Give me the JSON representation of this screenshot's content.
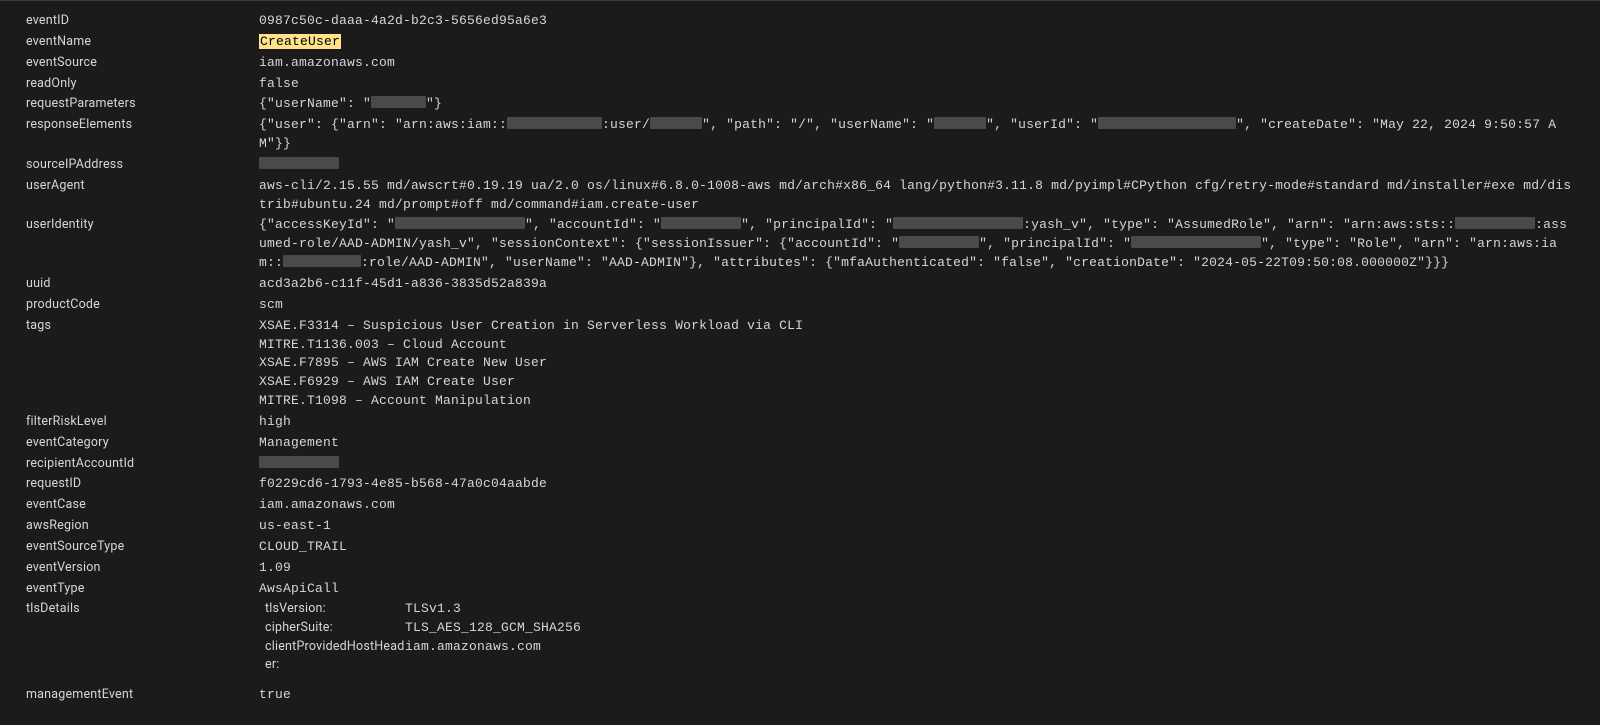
{
  "fields": {
    "eventID": {
      "label": "eventID",
      "value": "0987c50c-daaa-4a2d-b2c3-5656ed95a6e3"
    },
    "eventName": {
      "label": "eventName",
      "value": "CreateUser"
    },
    "eventSource": {
      "label": "eventSource",
      "value": "iam.amazonaws.com"
    },
    "readOnly": {
      "label": "readOnly",
      "value": "false"
    },
    "requestParameters": {
      "label": "requestParameters",
      "segments": [
        {
          "t": "{\"userName\": \""
        },
        {
          "redact": 55
        },
        {
          "t": "\"}"
        }
      ]
    },
    "responseElements": {
      "label": "responseElements",
      "segments": [
        {
          "t": "{\"user\": {\"arn\": \"arn:aws:iam::"
        },
        {
          "redact": 95
        },
        {
          "t": ":user/"
        },
        {
          "redact": 52
        },
        {
          "t": "\", \"path\": \"/\", \"userName\": \""
        },
        {
          "redact": 52
        },
        {
          "t": "\", \"userId\": \""
        },
        {
          "redact": 138
        },
        {
          "t": "\", \"createDate\": \"May 22, 2024 9:50:57 AM\"}}"
        }
      ]
    },
    "sourceIPAddress": {
      "label": "sourceIPAddress",
      "segments": [
        {
          "redact": 80
        }
      ]
    },
    "userAgent": {
      "label": "userAgent",
      "value": "aws-cli/2.15.55 md/awscrt#0.19.19 ua/2.0 os/linux#6.8.0-1008-aws md/arch#x86_64 lang/python#3.11.8 md/pyimpl#CPython cfg/retry-mode#standard md/installer#exe md/distrib#ubuntu.24 md/prompt#off md/command#iam.create-user"
    },
    "userIdentity": {
      "label": "userIdentity",
      "segments": [
        {
          "t": "{\"accessKeyId\": \""
        },
        {
          "redact": 130
        },
        {
          "t": "\", \"accountId\": \""
        },
        {
          "redact": 80
        },
        {
          "t": "\", \"principalId\": \""
        },
        {
          "redact": 130
        },
        {
          "t": ":yash_v\", \"type\": \"AssumedRole\", \"arn\": \"arn:aws:sts::"
        },
        {
          "redact": 80
        },
        {
          "t": ":assumed-role/AAD-ADMIN/yash_v\", \"sessionContext\": {\"sessionIssuer\": {\"accountId\": \""
        },
        {
          "redact": 80
        },
        {
          "t": "\", \"principalId\": \""
        },
        {
          "redact": 130
        },
        {
          "t": "\", \"type\": \"Role\", \"arn\": \"arn:aws:iam::"
        },
        {
          "redact": 78
        },
        {
          "t": ":role/AAD-ADMIN\", \"userName\": \"AAD-ADMIN\"}, \"attributes\": {\"mfaAuthenticated\": \"false\", \"creationDate\": \"2024-05-22T09:50:08.000000Z\"}}}"
        }
      ]
    },
    "uuid": {
      "label": "uuid",
      "value": "acd3a2b6-c11f-45d1-a836-3835d52a839a"
    },
    "productCode": {
      "label": "productCode",
      "value": "scm"
    },
    "tags": {
      "label": "tags",
      "lines": [
        "XSAE.F3314 – Suspicious User Creation in Serverless Workload via CLI",
        "MITRE.T1136.003 – Cloud Account",
        "XSAE.F7895 – AWS IAM Create New User",
        "XSAE.F6929 – AWS IAM Create User",
        "MITRE.T1098 – Account Manipulation"
      ]
    },
    "filterRiskLevel": {
      "label": "filterRiskLevel",
      "value": "high"
    },
    "eventCategory": {
      "label": "eventCategory",
      "value": "Management"
    },
    "recipientAccountId": {
      "label": "recipientAccountId",
      "segments": [
        {
          "redact": 80
        }
      ]
    },
    "requestID": {
      "label": "requestID",
      "value": "f0229cd6-1793-4e85-b568-47a0c04aabde"
    },
    "eventCase": {
      "label": "eventCase",
      "value": "iam.amazonaws.com"
    },
    "awsRegion": {
      "label": "awsRegion",
      "value": "us-east-1"
    },
    "eventSourceType": {
      "label": "eventSourceType",
      "value": "CLOUD_TRAIL"
    },
    "eventVersion": {
      "label": "eventVersion",
      "value": "1.09"
    },
    "eventType": {
      "label": "eventType",
      "value": "AwsApiCall"
    },
    "tlsDetails": {
      "label": "tlsDetails",
      "nested": [
        {
          "key": "tlsVersion:",
          "val": "TLSv1.3"
        },
        {
          "key": "cipherSuite:",
          "val": "TLS_AES_128_GCM_SHA256"
        },
        {
          "key": "clientProvidedHostHeader:",
          "val": "iam.amazonaws.com"
        }
      ]
    },
    "managementEvent": {
      "label": "managementEvent",
      "value": "true"
    }
  }
}
